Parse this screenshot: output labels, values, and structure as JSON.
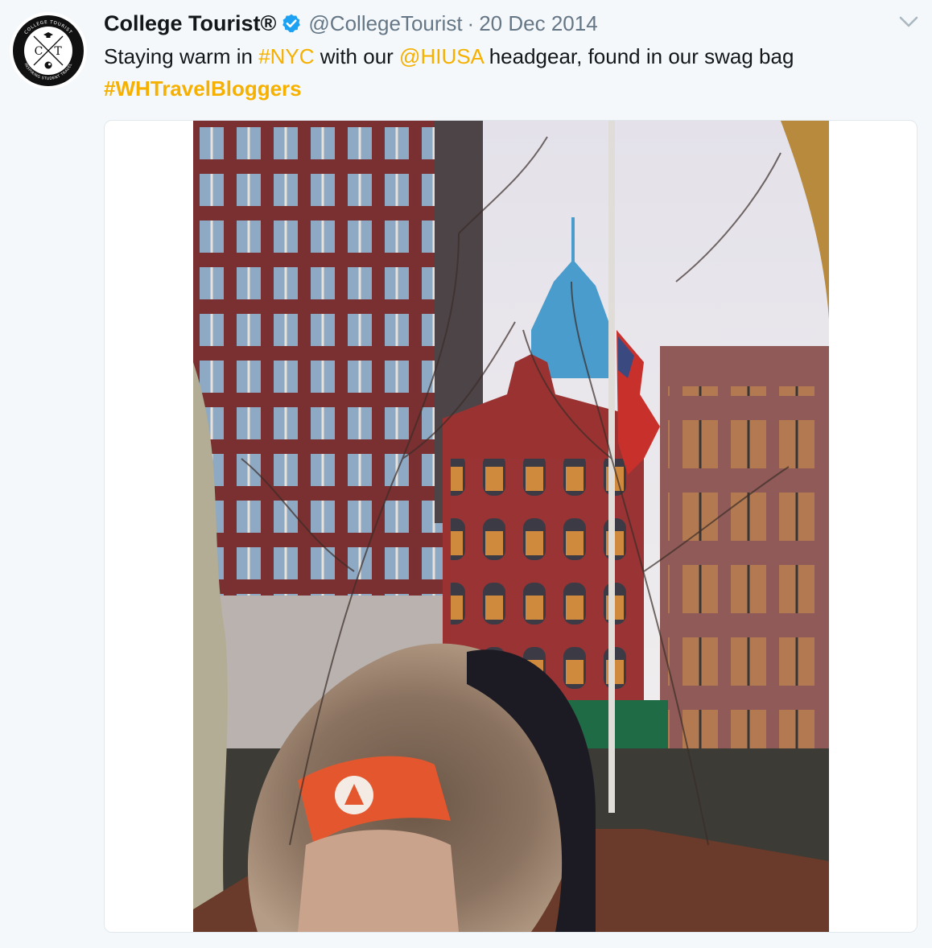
{
  "tweet": {
    "author": {
      "name": "College Tourist®",
      "handle": "@CollegeTourist",
      "verified": true,
      "avatar_icon": "college-tourist-logo-icon",
      "avatar_text": {
        "ring_top": "COLLEGE TOURIST",
        "ring_bottom": "INSPIRING STUDENT TRAVEL",
        "left_letter": "C",
        "right_letter": "T"
      }
    },
    "separator": "·",
    "date": "20 Dec 2014",
    "menu_icon": "chevron-down-icon",
    "text_parts": {
      "p1": "Staying warm in ",
      "tag_nyc": "#NYC",
      "p2": " with our ",
      "mention_hiusa": "@HIUSA",
      "p3": " headgear, found in our swag bag",
      "tag_wh": "#WHTravelBloggers"
    },
    "media": {
      "type": "photo",
      "subject": "woman in fur-trimmed hood with orange HI USA headband in front of red brick buildings and American flag in NYC"
    }
  },
  "colors": {
    "link": "#f5b000",
    "text": "#14171a",
    "secondary": "#657786",
    "verified": "#1da1f2",
    "background": "#f5f8fa"
  }
}
